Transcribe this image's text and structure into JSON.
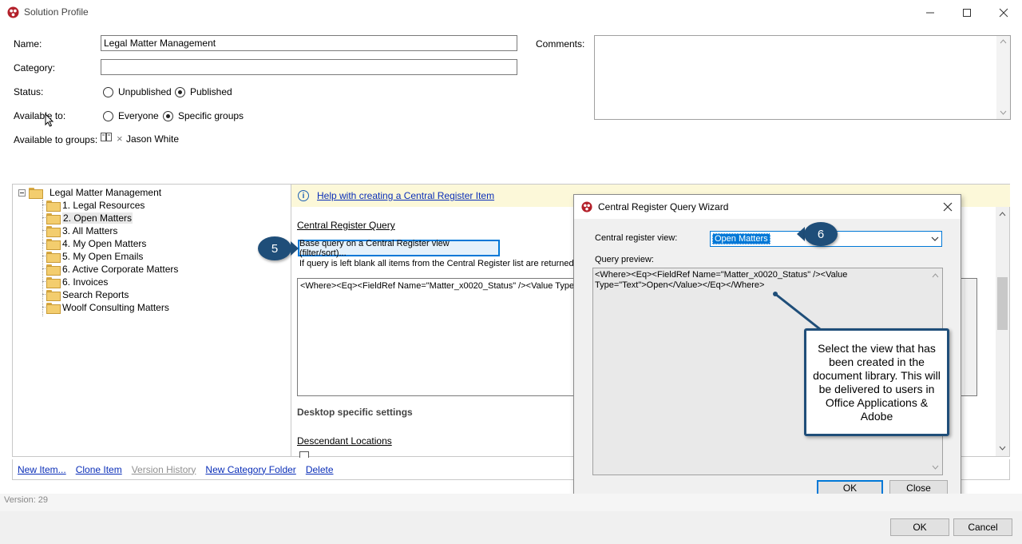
{
  "window": {
    "title": "Solution Profile"
  },
  "form": {
    "name_label": "Name:",
    "name_value": "Legal Matter Management",
    "category_label": "Category:",
    "category_value": "",
    "status_label": "Status:",
    "status_options": [
      "Unpublished",
      "Published"
    ],
    "status_selected": "Published",
    "available_label": "Available to:",
    "available_options": [
      "Everyone",
      "Specific groups"
    ],
    "available_selected": "Specific groups",
    "groups_label": "Available to groups:",
    "group_remove": "×",
    "group_name": "Jason White",
    "comments_label": "Comments:"
  },
  "tree": {
    "root": "Legal Matter Management",
    "items": [
      "1. Legal Resources",
      "2. Open Matters",
      "3. All Matters",
      "4. My Open Matters",
      "5. My Open Emails",
      "6. Active Corporate Matters",
      "6. Invoices",
      "Search Reports",
      "Woolf Consulting Matters"
    ],
    "selected": "2. Open Matters"
  },
  "actions": {
    "new_item": "New Item...",
    "clone_item": "Clone Item",
    "version_history": "Version History",
    "new_category_folder": "New Category Folder",
    "delete": "Delete"
  },
  "right_panel": {
    "help_link": "Help with creating a Central Register Item",
    "section_title": "Central Register Query",
    "base_query_button": "Base query on a Central Register view (filter/sort)...",
    "blank_note": "If query is left blank all items from the Central Register list are returned.",
    "query_text": "<Where><Eq><FieldRef Name=\"Matter_x0020_Status\" /><Value Type=",
    "desktop_heading": "Desktop specific settings",
    "descendant_link": "Descendant Locations"
  },
  "wizard": {
    "title": "Central Register Query Wizard",
    "view_label": "Central register view:",
    "view_value": "Open Matters",
    "preview_label": "Query preview:",
    "preview_line1": "<Where><Eq><FieldRef Name=\"Matter_x0020_Status\" /><Value",
    "preview_line2": "Type=\"Text\">Open</Value></Eq></Where>",
    "ok": "OK",
    "close": "Close"
  },
  "callouts": {
    "step5": "5",
    "step6": "6",
    "note": "Select the view that has been created in the document library. This will be delivered to users in Office Applications & Adobe"
  },
  "footer": {
    "version": "Version: 29",
    "ok": "OK",
    "cancel": "Cancel"
  },
  "colors": {
    "accent": "#0078d7",
    "callout": "#1f4e79",
    "help_bar": "#fcf8d9"
  }
}
